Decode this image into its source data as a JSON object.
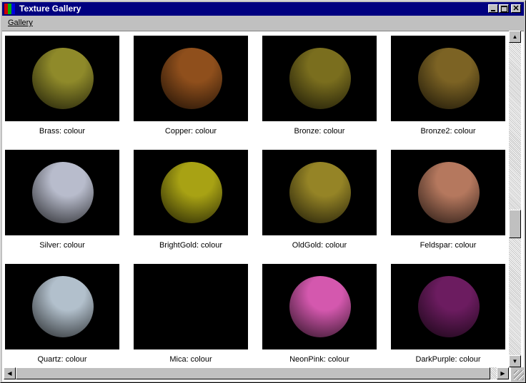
{
  "window": {
    "title": "Texture Gallery"
  },
  "menu": {
    "gallery": "Gallery"
  },
  "textures": [
    {
      "label": "Brass: colour",
      "color": "#8f8a2a"
    },
    {
      "label": "Copper: colour",
      "color": "#8f4f1c"
    },
    {
      "label": "Bronze: colour",
      "color": "#7a6e1e"
    },
    {
      "label": "Bronze2: colour",
      "color": "#7c6324"
    },
    {
      "label": "Silver: colour",
      "color": "#b8bccc"
    },
    {
      "label": "BrightGold: colour",
      "color": "#a8a214"
    },
    {
      "label": "OldGold: colour",
      "color": "#958426"
    },
    {
      "label": "Feldspar: colour",
      "color": "#b5785e"
    },
    {
      "label": "Quartz: colour",
      "color": "#b2c0cc"
    },
    {
      "label": "Mica: colour",
      "color": "#000000"
    },
    {
      "label": "NeonPink: colour",
      "color": "#d458ae"
    },
    {
      "label": "DarkPurple: colour",
      "color": "#6c1c60"
    }
  ]
}
